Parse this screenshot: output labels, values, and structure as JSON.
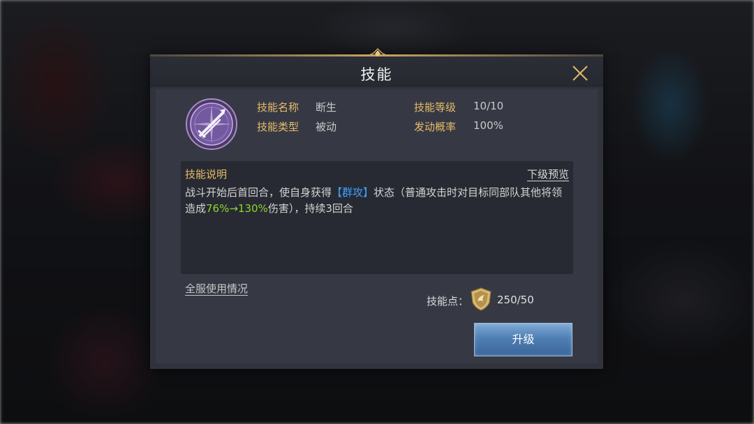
{
  "dialog": {
    "title": "技能",
    "close_icon": "close-icon"
  },
  "skill": {
    "icon": "crossed-swords-icon",
    "name_label": "技能名称",
    "name_value": "断生",
    "type_label": "技能类型",
    "type_value": "被动",
    "level_label": "技能等级",
    "level_value": "10/10",
    "rate_label": "发动概率",
    "rate_value": "100%"
  },
  "description": {
    "title": "技能说明",
    "lower_preview": "下级预览",
    "text_part1": "战斗开始后首回合，使自身获得",
    "highlight_status": "【群攻】",
    "text_part2": "状态（普通攻击时对目标同部队其他将领造成",
    "highlight_value": "76%→130%",
    "text_part3": "伤害），持续3回合"
  },
  "footer": {
    "server_usage": "全服使用情况",
    "points_label": "技能点：",
    "points_icon": "skill-point-shield-icon",
    "points_value": "250/50",
    "upgrade_label": "升级"
  },
  "colors": {
    "accent_gold": "#e7bc68",
    "highlight_blue": "#3fa0ff",
    "highlight_green": "#8ed52f",
    "button_blue": "#4f7fb5"
  }
}
